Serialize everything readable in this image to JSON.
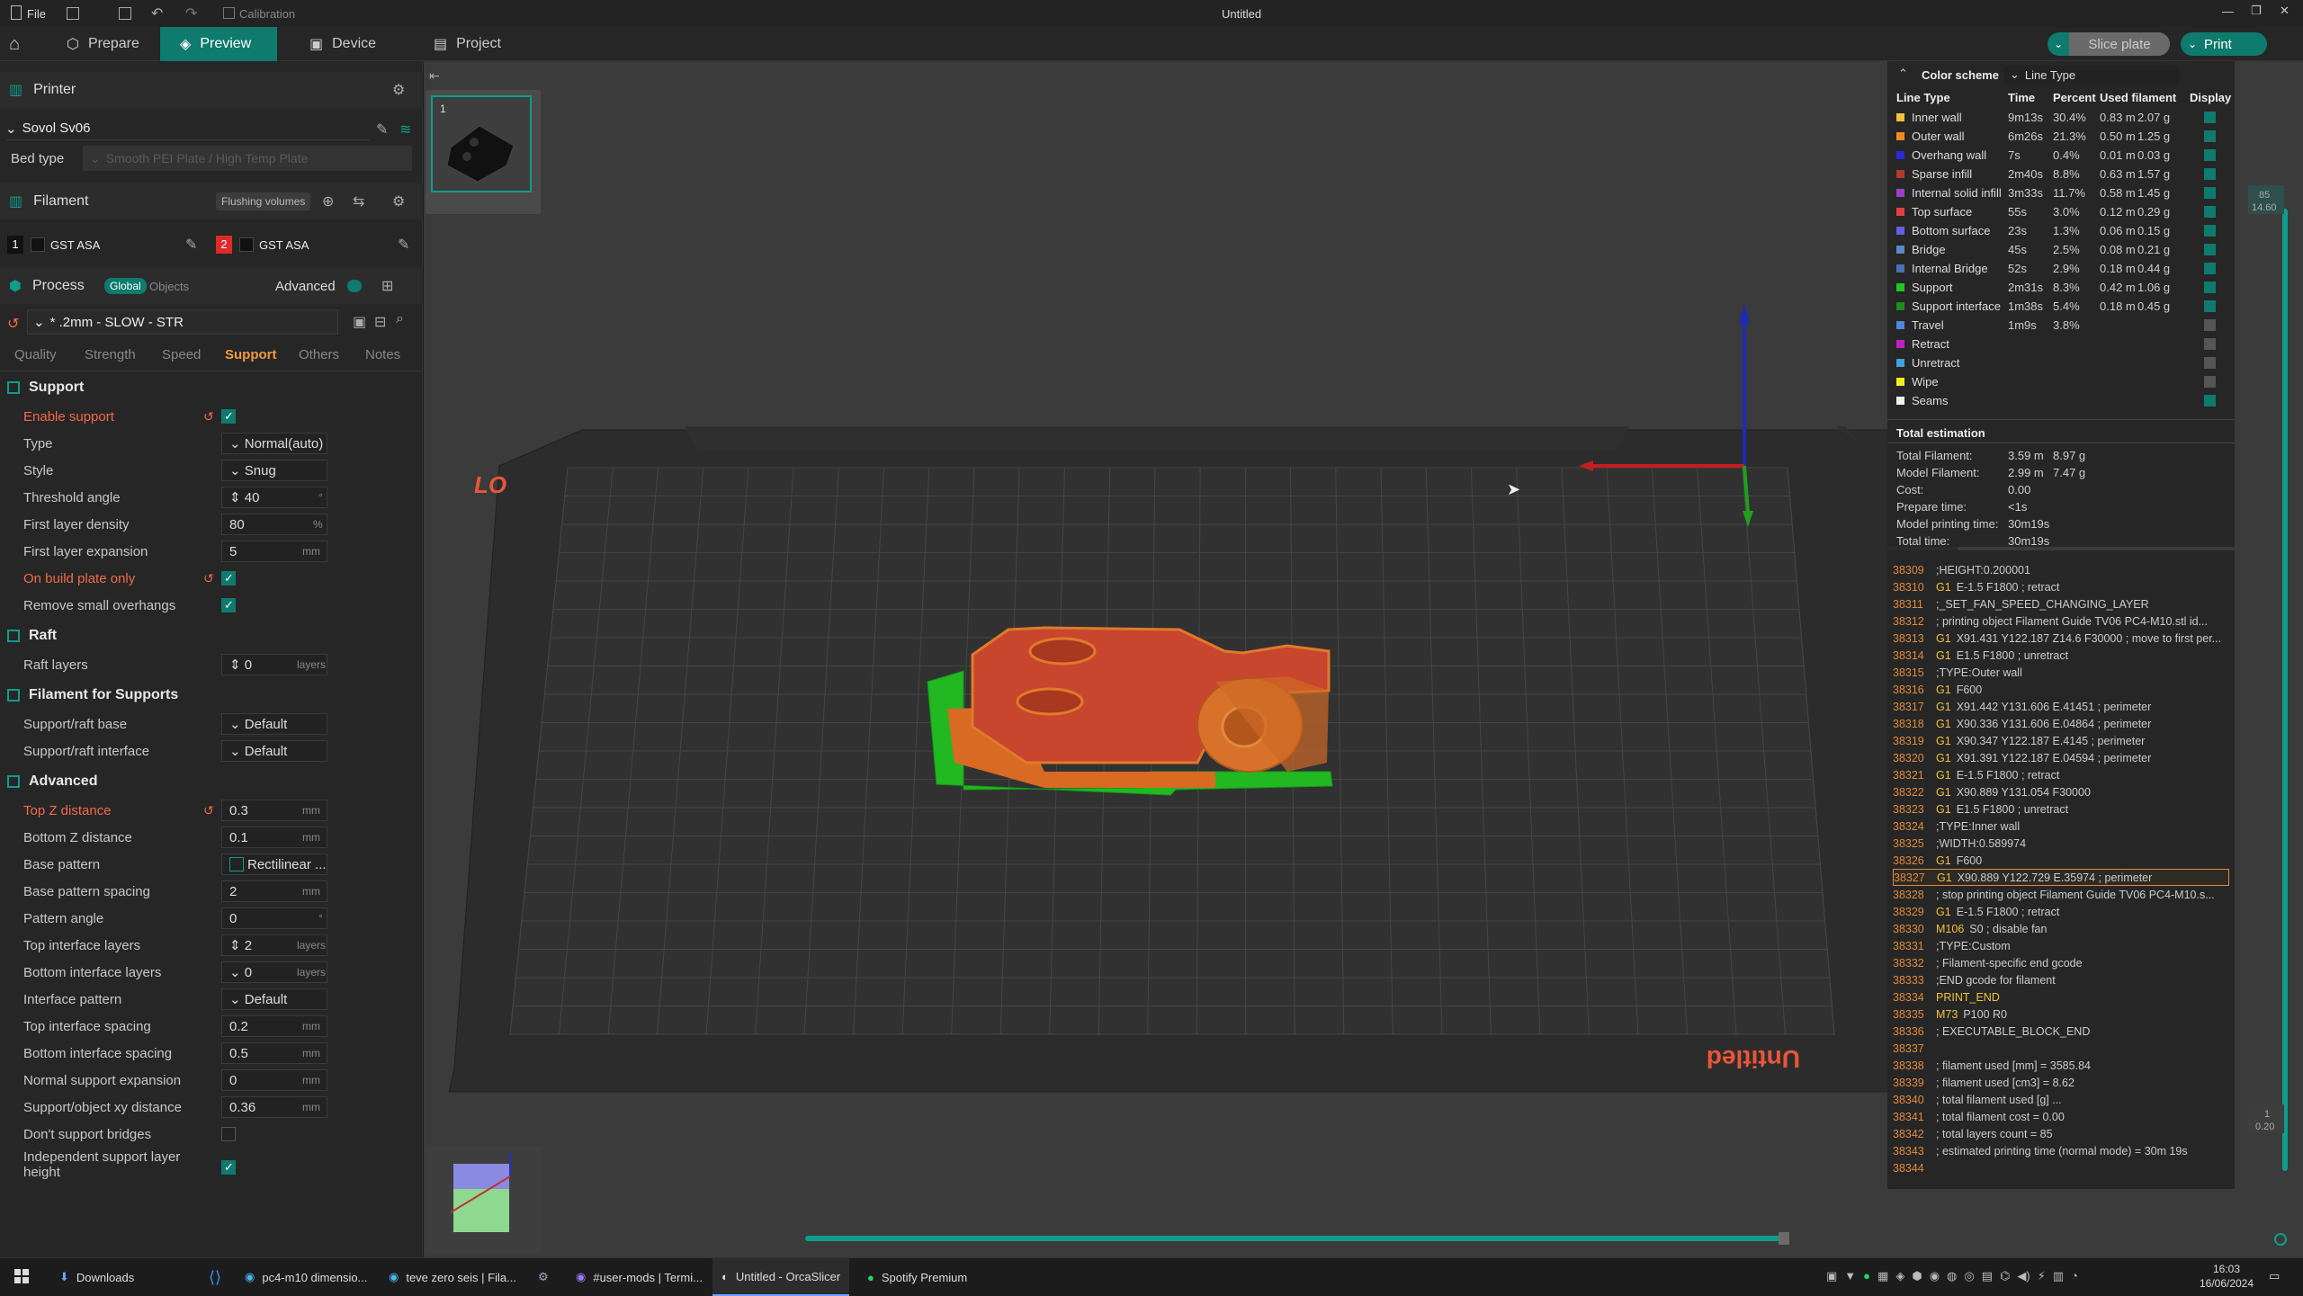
{
  "titlebar": {
    "menu_file": "File",
    "calibration": "Calibration",
    "title": "Untitled"
  },
  "menubar": {
    "prepare": "Prepare",
    "preview": "Preview",
    "device": "Device",
    "project": "Project",
    "slice_plate": "Slice plate",
    "print": "Print"
  },
  "printer": {
    "header": "Printer",
    "name": "Sovol Sv06",
    "bed_type_label": "Bed type",
    "bed_type_value": "Smooth PEI Plate / High Temp Plate"
  },
  "filament": {
    "header": "Filament",
    "flushing": "Flushing volumes",
    "slot1_num": "1",
    "slot1_name": "GST ASA",
    "slot2_num": "2",
    "slot2_name": "GST ASA"
  },
  "process": {
    "header": "Process",
    "global": "Global",
    "objects": "Objects",
    "advanced": "Advanced",
    "preset": "* .2mm - SLOW - STR",
    "tabs": [
      "Quality",
      "Strength",
      "Speed",
      "Support",
      "Others",
      "Notes"
    ]
  },
  "support": {
    "section": "Support",
    "enable_support": "Enable support",
    "type_label": "Type",
    "type_value": "Normal(auto)",
    "style_label": "Style",
    "style_value": "Snug",
    "threshold_label": "Threshold angle",
    "threshold_value": "40",
    "threshold_unit": "°",
    "first_density_label": "First layer density",
    "first_density_value": "80",
    "first_density_unit": "%",
    "first_expansion_label": "First layer expansion",
    "first_expansion_value": "5",
    "first_expansion_unit": "mm",
    "on_build_plate": "On build plate only",
    "remove_small": "Remove small overhangs"
  },
  "raft": {
    "section": "Raft",
    "layers_label": "Raft layers",
    "layers_value": "0",
    "layers_unit": "layers"
  },
  "filament_supports": {
    "section": "Filament for Supports",
    "base_label": "Support/raft base",
    "base_value": "Default",
    "interface_label": "Support/raft interface",
    "interface_value": "Default"
  },
  "advanced": {
    "section": "Advanced",
    "rows": [
      {
        "label": "Top Z distance",
        "value": "0.3",
        "unit": "mm"
      },
      {
        "label": "Bottom Z distance",
        "value": "0.1",
        "unit": "mm"
      },
      {
        "label": "Base pattern",
        "value": "Rectilinear ...",
        "unit": ""
      },
      {
        "label": "Base pattern spacing",
        "value": "2",
        "unit": "mm"
      },
      {
        "label": "Pattern angle",
        "value": "0",
        "unit": "°"
      },
      {
        "label": "Top interface layers",
        "value": "2",
        "unit": "layers"
      },
      {
        "label": "Bottom interface layers",
        "value": "0",
        "unit": "layers"
      },
      {
        "label": "Interface pattern",
        "value": "Default",
        "unit": ""
      },
      {
        "label": "Top interface spacing",
        "value": "0.2",
        "unit": "mm"
      },
      {
        "label": "Bottom interface spacing",
        "value": "0.5",
        "unit": "mm"
      },
      {
        "label": "Normal support expansion",
        "value": "0",
        "unit": "mm"
      },
      {
        "label": "Support/object xy distance",
        "value": "0.36",
        "unit": "mm"
      }
    ],
    "dont_support_bridges": "Don't support bridges",
    "independent_layer_height_1": "Independent support layer",
    "independent_layer_height_2": "height"
  },
  "viewport": {
    "plate_number": "1",
    "plate_label_top": "LO",
    "plate_label_bottom": "Untitled",
    "slider_top_1": "85",
    "slider_top_2": "14.60",
    "slider_bottom_1": "1",
    "slider_bottom_2": "0.20"
  },
  "legend": {
    "color_scheme": "Color scheme",
    "scheme_value": "Line Type",
    "headers": [
      "Line Type",
      "Time",
      "Percent",
      "Used filament",
      "Display"
    ],
    "items": [
      {
        "name": "Inner wall",
        "color": "#f2c23c",
        "time": "9m13s",
        "percent": "30.4%",
        "len": "0.83 m",
        "mass": "2.07 g",
        "display": true
      },
      {
        "name": "Outer wall",
        "color": "#f08a24",
        "time": "6m26s",
        "percent": "21.3%",
        "len": "0.50 m",
        "mass": "1.25 g",
        "display": true
      },
      {
        "name": "Overhang wall",
        "color": "#2a2ad6",
        "time": "7s",
        "percent": "0.4%",
        "len": "0.01 m",
        "mass": "0.03 g",
        "display": true
      },
      {
        "name": "Sparse infill",
        "color": "#b23a2a",
        "time": "2m40s",
        "percent": "8.8%",
        "len": "0.63 m",
        "mass": "1.57 g",
        "display": true
      },
      {
        "name": "Internal solid infill",
        "color": "#9a40c8",
        "time": "3m33s",
        "percent": "11.7%",
        "len": "0.58 m",
        "mass": "1.45 g",
        "display": true
      },
      {
        "name": "Top surface",
        "color": "#e04040",
        "time": "55s",
        "percent": "3.0%",
        "len": "0.12 m",
        "mass": "0.29 g",
        "display": true
      },
      {
        "name": "Bottom surface",
        "color": "#6060e0",
        "time": "23s",
        "percent": "1.3%",
        "len": "0.06 m",
        "mass": "0.15 g",
        "display": true
      },
      {
        "name": "Bridge",
        "color": "#5a88c8",
        "time": "45s",
        "percent": "2.5%",
        "len": "0.08 m",
        "mass": "0.21 g",
        "display": true
      },
      {
        "name": "Internal Bridge",
        "color": "#4a70b8",
        "time": "52s",
        "percent": "2.9%",
        "len": "0.18 m",
        "mass": "0.44 g",
        "display": true
      },
      {
        "name": "Support",
        "color": "#20c820",
        "time": "2m31s",
        "percent": "8.3%",
        "len": "0.42 m",
        "mass": "1.06 g",
        "display": true
      },
      {
        "name": "Support interface",
        "color": "#208a20",
        "time": "1m38s",
        "percent": "5.4%",
        "len": "0.18 m",
        "mass": "0.45 g",
        "display": true
      },
      {
        "name": "Travel",
        "color": "#4a8ae0",
        "time": "1m9s",
        "percent": "3.8%",
        "len": "",
        "mass": "",
        "display": false
      },
      {
        "name": "Retract",
        "color": "#c020c0",
        "time": "",
        "percent": "",
        "len": "",
        "mass": "",
        "display": false
      },
      {
        "name": "Unretract",
        "color": "#40a0e0",
        "time": "",
        "percent": "",
        "len": "",
        "mass": "",
        "display": false
      },
      {
        "name": "Wipe",
        "color": "#f0f020",
        "time": "",
        "percent": "",
        "len": "",
        "mass": "",
        "display": false
      },
      {
        "name": "Seams",
        "color": "#f0f0f0",
        "time": "",
        "percent": "",
        "len": "",
        "mass": "",
        "display": true
      }
    ],
    "total_header": "Total estimation",
    "totals": [
      {
        "label": "Total Filament:",
        "v1": "3.59 m",
        "v2": "8.97 g"
      },
      {
        "label": "Model Filament:",
        "v1": "2.99 m",
        "v2": "7.47 g"
      },
      {
        "label": "Cost:",
        "v1": "0.00",
        "v2": ""
      },
      {
        "label": "Prepare time:",
        "v1": "<1s",
        "v2": ""
      },
      {
        "label": "Model printing time:",
        "v1": "30m19s",
        "v2": ""
      },
      {
        "label": "Total time:",
        "v1": "30m19s",
        "v2": ""
      }
    ]
  },
  "gcode": {
    "lines": [
      {
        "n": "38309",
        "cmd": "",
        "rest": ";HEIGHT:0.200001"
      },
      {
        "n": "38310",
        "cmd": "G1",
        "rest": "E-1.5 F1800 ; retract"
      },
      {
        "n": "38311",
        "cmd": "",
        "rest": ";_SET_FAN_SPEED_CHANGING_LAYER"
      },
      {
        "n": "38312",
        "cmd": "",
        "rest": "; printing object Filament Guide TV06 PC4-M10.stl id..."
      },
      {
        "n": "38313",
        "cmd": "G1",
        "rest": "X91.431 Y122.187 Z14.6 F30000 ; move to first per..."
      },
      {
        "n": "38314",
        "cmd": "G1",
        "rest": "E1.5 F1800 ; unretract"
      },
      {
        "n": "38315",
        "cmd": "",
        "rest": ";TYPE:Outer wall"
      },
      {
        "n": "38316",
        "cmd": "G1",
        "rest": "F600"
      },
      {
        "n": "38317",
        "cmd": "G1",
        "rest": "X91.442 Y131.606 E.41451 ; perimeter"
      },
      {
        "n": "38318",
        "cmd": "G1",
        "rest": "X90.336 Y131.606 E.04864 ; perimeter"
      },
      {
        "n": "38319",
        "cmd": "G1",
        "rest": "X90.347 Y122.187 E.4145 ; perimeter"
      },
      {
        "n": "38320",
        "cmd": "G1",
        "rest": "X91.391 Y122.187 E.04594 ; perimeter"
      },
      {
        "n": "38321",
        "cmd": "G1",
        "rest": "E-1.5 F1800 ; retract"
      },
      {
        "n": "38322",
        "cmd": "G1",
        "rest": "X90.889 Y131.054 F30000"
      },
      {
        "n": "38323",
        "cmd": "G1",
        "rest": "E1.5 F1800 ; unretract"
      },
      {
        "n": "38324",
        "cmd": "",
        "rest": ";TYPE:Inner wall"
      },
      {
        "n": "38325",
        "cmd": "",
        "rest": ";WIDTH:0.589974"
      },
      {
        "n": "38326",
        "cmd": "G1",
        "rest": "F600"
      },
      {
        "n": "38327",
        "cmd": "G1",
        "rest": "X90.889 Y122.729 E.35974 ; perimeter"
      },
      {
        "n": "38328",
        "cmd": "",
        "rest": "; stop printing object Filament Guide TV06 PC4-M10.s..."
      },
      {
        "n": "38329",
        "cmd": "G1",
        "rest": "E-1.5 F1800 ; retract"
      },
      {
        "n": "38330",
        "cmd": "M106",
        "rest": "S0 ; disable fan"
      },
      {
        "n": "38331",
        "cmd": "",
        "rest": ";TYPE:Custom"
      },
      {
        "n": "38332",
        "cmd": "",
        "rest": "; Filament-specific end gcode"
      },
      {
        "n": "38333",
        "cmd": "",
        "rest": ";END gcode for filament"
      },
      {
        "n": "38334",
        "cmd": "PRINT_END",
        "rest": ""
      },
      {
        "n": "38335",
        "cmd": "M73",
        "rest": "P100 R0"
      },
      {
        "n": "38336",
        "cmd": "",
        "rest": "; EXECUTABLE_BLOCK_END"
      },
      {
        "n": "38337",
        "cmd": "",
        "rest": ""
      },
      {
        "n": "38338",
        "cmd": "",
        "rest": "; filament used [mm] = 3585.84"
      },
      {
        "n": "38339",
        "cmd": "",
        "rest": "; filament used [cm3] = 8.62"
      },
      {
        "n": "38340",
        "cmd": "",
        "rest": "; total filament used [g] ..."
      },
      {
        "n": "38341",
        "cmd": "",
        "rest": "; total filament cost = 0.00"
      },
      {
        "n": "38342",
        "cmd": "",
        "rest": "; total layers count = 85"
      },
      {
        "n": "38343",
        "cmd": "",
        "rest": "; estimated printing time (normal mode) = 30m 19s"
      },
      {
        "n": "38344",
        "cmd": "",
        "rest": ""
      }
    ],
    "highlight": "38327"
  },
  "taskbar": {
    "items": [
      "Downloads",
      "pc4-m10 dimensio...",
      "teve zero seis | Fila...",
      "#user-mods | Termi...",
      "Untitled - OrcaSlicer",
      "Spotify Premium"
    ],
    "time": "16:03",
    "date": "16/06/2024"
  },
  "colors": {
    "accent": "#0f7a6e",
    "changed": "#f2694a",
    "model_top": "#c8452e",
    "model_wall": "#e07a2a",
    "support": "#22c022"
  }
}
